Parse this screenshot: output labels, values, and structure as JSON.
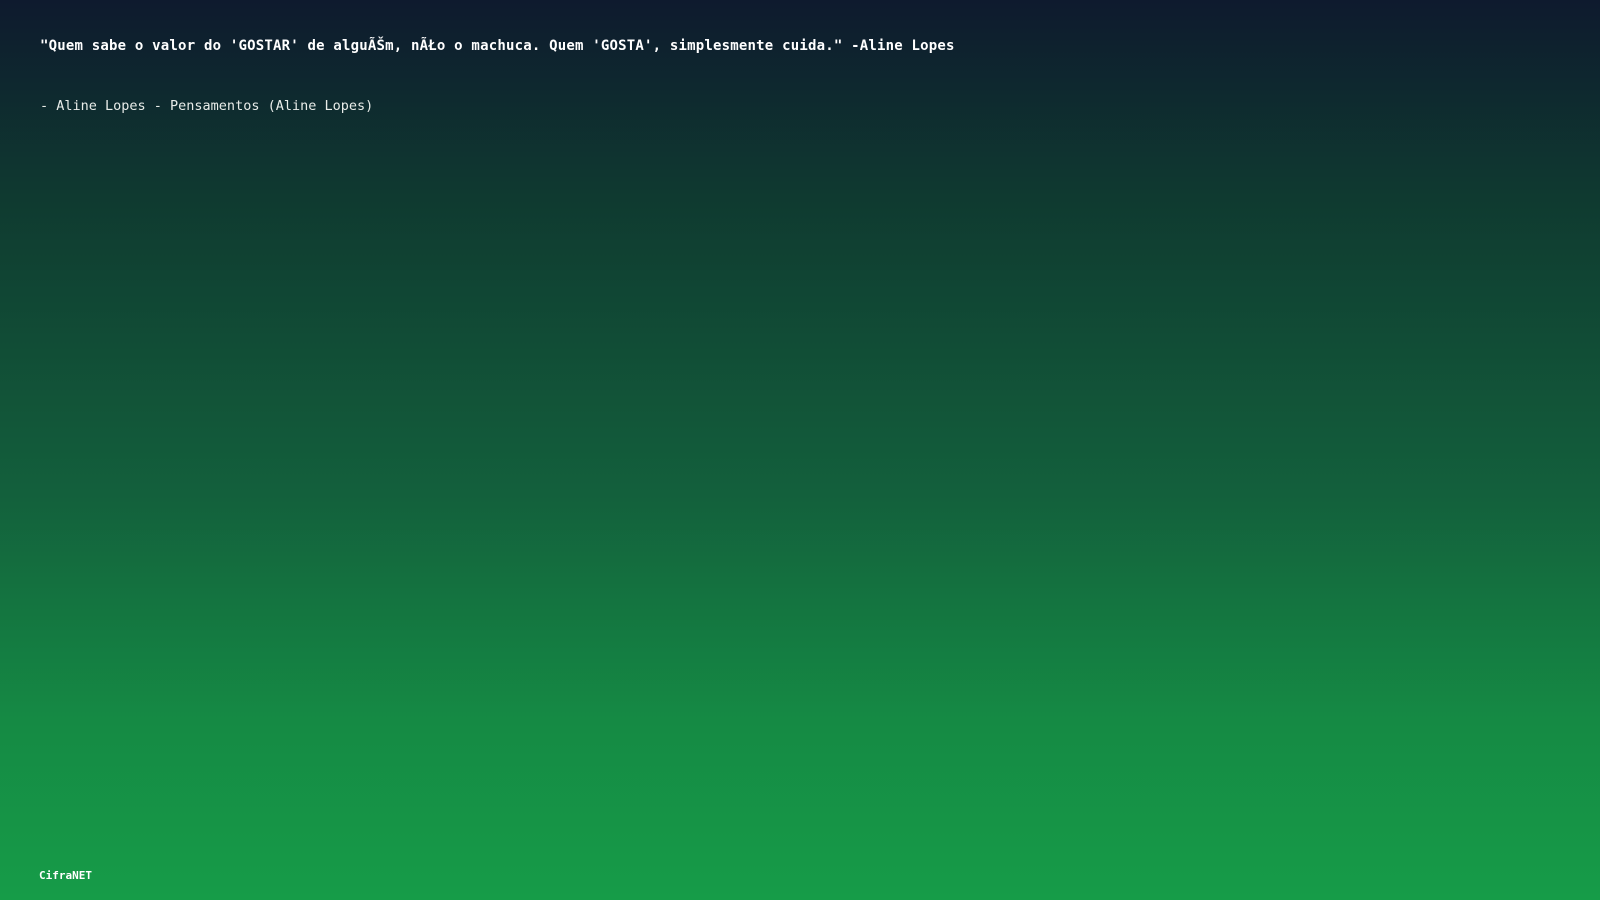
{
  "quote": {
    "text": "\"Quem sabe o valor do 'GOSTAR' de alguÃŠm, nÃŁo o machuca. Quem 'GOSTA', simplesmente cuida.\" -Aline Lopes"
  },
  "attribution": {
    "text": "- Aline Lopes - Pensamentos (Aline Lopes)"
  },
  "brand": {
    "text": "CifraNET"
  },
  "colors": {
    "gradient_top": "#0e1a2e",
    "gradient_bottom": "#169c48",
    "text": "#ffffff"
  }
}
